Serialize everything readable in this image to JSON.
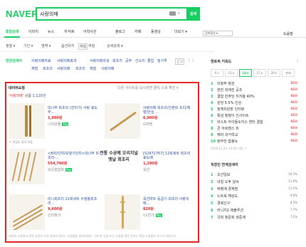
{
  "header": {
    "logo": "NAVER",
    "query": "사랑의매",
    "search_btn": "검색"
  },
  "tabs": [
    "통합검색",
    "이미지",
    "뉴스",
    "지식iN",
    "어학사전",
    "블로그",
    "카페",
    "동영상",
    "더보기"
  ],
  "tab_more_arrow": "▾",
  "search_option": "검색옵션 ▾",
  "top_right": "도움말",
  "filters": [
    "정렬 ▾",
    "기간 ▾",
    "영역 ▾",
    "옵션유지",
    "꺼짐",
    "켜짐",
    "상세검색 ▾"
  ],
  "related": {
    "title": "연관검색어",
    "row1": [
      "사랑의매자료",
      "사랑의매효과",
      "사랑의매유성",
      "회초리",
      "공부",
      "간소리",
      "졸업",
      "밀가루"
    ],
    "row2": [
      "체벌",
      "회초리",
      "사랑의매",
      "회초리",
      "체벌",
      "사랑의매"
    ],
    "controls": [
      "신고",
      "〈",
      "〉"
    ]
  },
  "shop": {
    "title": "네이버쇼핑",
    "right_text": "다른 사이트를 보시려면 클릭 으로 확인 ▾",
    "count_prefix": "'사랑의매'",
    "count_mid": "상품",
    "count_num": "1,120건",
    "items": [
      {
        "name": "대나무 회초리 (진미가) 사랑 효도 부...",
        "price": "1,900원",
        "mall": "나라감몰",
        "badge": "Pay"
      },
      {
        "name": "사랑의매 회초리/간혼회 초리/체벌/안심 ...",
        "price": "6,900원",
        "mall": "G마켓",
        "badge": ""
      },
      {
        "name": "<B자/단위/보행기단위>대나무 회초리-...",
        "price": "554,700원",
        "mall": "모은솔잡화",
        "badge": "Pay"
      },
      {
        "name": "[S2472767] 12회세트 회초리 효도매",
        "price": "1,290원",
        "mall": "옥션",
        "badge": ""
      },
      {
        "name": "미니회초리 22회세트 수정봉회초리...",
        "price": "9,600원",
        "mall": "인터파크",
        "badge": ""
      },
      {
        "name": "옥션마트 등굽기 회초리 사랑의매...",
        "price": "820원",
        "mall": "11번가",
        "badge": "Pay"
      }
    ],
    "ad_text": "전통 수공예 오리지널 옛날 회초리",
    "checkbox": "안심도 찾아 모음",
    "notice": "네이버 쇼핑에서 관련 상품의 가격 정보와 원하는 쇼핑몰을 찾아보세요. 구매 한 상품 또는 쇼핑몰 관련 문의는 해당 쇼핑몰로 하시기 바랍니다."
  },
  "sidebar": {
    "title": "핫토픽 키워드",
    "more": "〉",
    "time_tabs": [
      "6시",
      "11시",
      "14시",
      "17시",
      "20시",
      "현재"
    ],
    "ranks": [
      {
        "n": "1",
        "t": "의정부 정관",
        "flag": "NEW"
      },
      {
        "n": "2",
        "t": "현빈 외래진 공조",
        "flag": "NEW"
      },
      {
        "n": "3",
        "t": "결합 민주당 지지율 40%",
        "flag": "NEW"
      },
      {
        "n": "4",
        "t": "원당 5.5% 인상",
        "flag": "NEW"
      },
      {
        "n": "5",
        "t": "정책위원장 인터뷰",
        "flag": "NEW"
      },
      {
        "n": "6",
        "t": "특검 정청이 인사이트",
        "flag": "NEW"
      },
      {
        "n": "7",
        "t": "비스트 아이돌도어스 연타 결합",
        "flag": "NEW"
      },
      {
        "n": "8",
        "t": "콘 아르벤스 외",
        "flag": "NEW"
      },
      {
        "n": "9",
        "t": "재미 과거학교",
        "flag": "NEW"
      },
      {
        "n": "10",
        "t": "정부전 합봉뉴",
        "flag": "NEW"
      }
    ],
    "date_note": "2016.12.24. 14:00 기준 ⓘ",
    "title2": "직장인 연계검색어",
    "ranks2": [
      {
        "n": "1",
        "t": "조선일보",
        "pct": "16.3%"
      },
      {
        "n": "2",
        "t": "내일 오후 날씨",
        "pct": "11.9%"
      },
      {
        "n": "3",
        "t": "박병계 경계점",
        "pct": "11.5%"
      },
      {
        "n": "4",
        "t": "노트북 해상도",
        "pct": "9.9%"
      },
      {
        "n": "5",
        "t": "경북인구",
        "pct": "8.5%"
      },
      {
        "n": "6",
        "t": "러니지2 레볼루션",
        "pct": "7.7%"
      },
      {
        "n": "7",
        "t": "국회 청문회 생중계",
        "pct": "7.1%"
      }
    ]
  },
  "colors": {
    "brand": "#19ce60",
    "highlight_border": "#e72727",
    "link": "#2b4fa3"
  }
}
